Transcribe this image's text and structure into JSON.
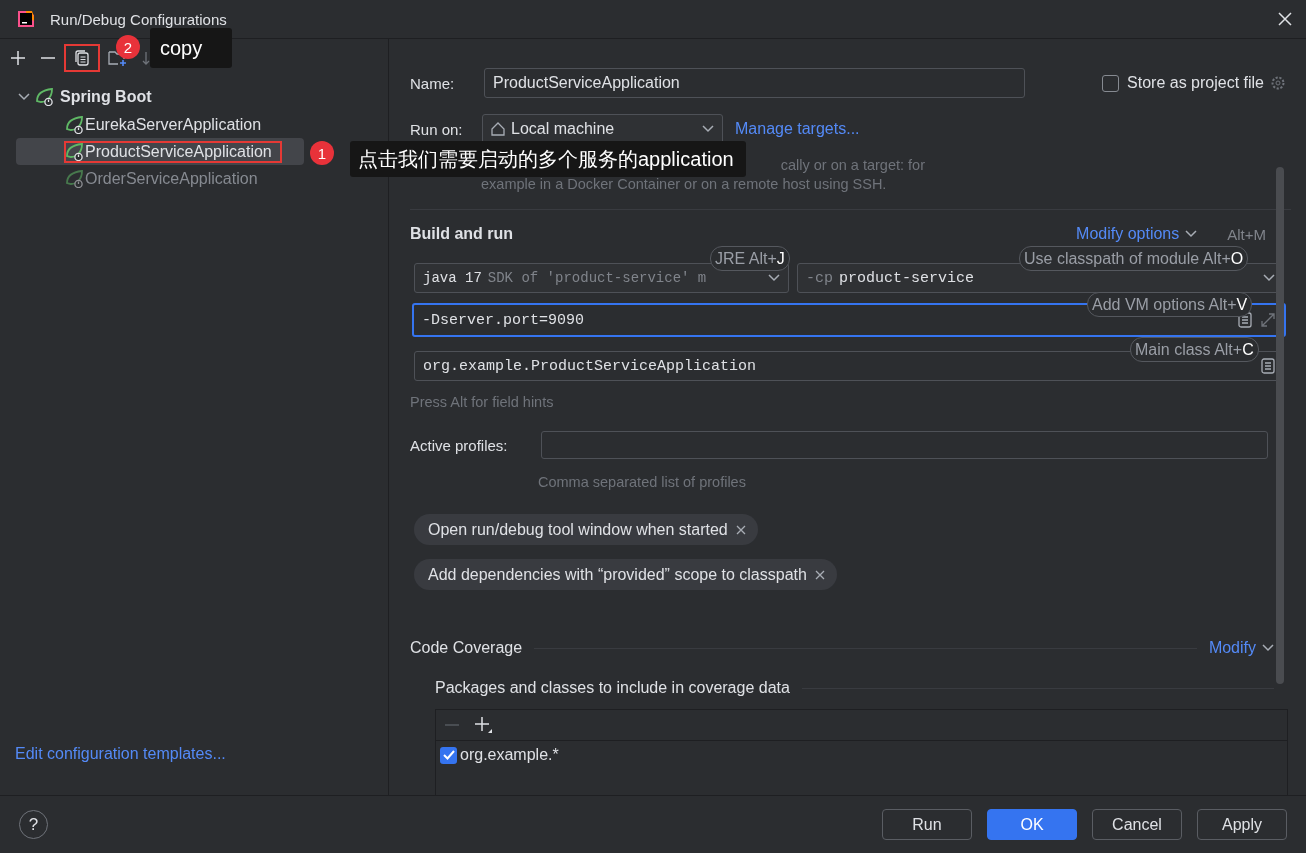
{
  "window": {
    "title": "Run/Debug Configurations"
  },
  "tree": {
    "label": "Spring Boot",
    "expanded": true,
    "children": [
      {
        "label": "EurekaServerApplication",
        "selected": false,
        "disabled": false,
        "highlighted": false
      },
      {
        "label": "ProductServiceApplication",
        "selected": true,
        "disabled": false,
        "highlighted": true
      },
      {
        "label": "OrderServiceApplication",
        "selected": false,
        "disabled": true,
        "highlighted": false
      }
    ]
  },
  "copy_highlighted": true,
  "templates_link": "Edit configuration templates...",
  "name": {
    "label": "Name:",
    "value": "ProductServiceApplication"
  },
  "store": {
    "label": "Store as project file",
    "checked": false
  },
  "run_on": {
    "label": "Run on:",
    "value": "Local machine",
    "link": "Manage targets...",
    "hint": [
      "cally or on a target: for",
      "example in a Docker Container or on a remote host using SSH."
    ]
  },
  "build": {
    "title": "Build and run",
    "modify": "Modify options",
    "modify_shortcut": "Alt+M",
    "jre": "java 17",
    "jre_hint": "SDK of 'product-service' m",
    "cp_prefix": "-cp",
    "cp_value": "product-service",
    "vm_options": "-Dserver.port=9090",
    "vm_focused": true,
    "main_class": "org.example.ProductServiceApplication",
    "field_hint": "Press Alt for field hints"
  },
  "shortcut_hints": [
    {
      "kind": "jre",
      "text": "JRE Alt+",
      "key": "J"
    },
    {
      "kind": "classpath",
      "text": "Use classpath of module Alt+",
      "key": "O"
    },
    {
      "kind": "vm",
      "text": "Add VM options Alt+",
      "key": "V"
    },
    {
      "kind": "main",
      "text": "Main class Alt+",
      "key": "C"
    }
  ],
  "profiles": {
    "label": "Active profiles:",
    "hint": "Comma separated list of profiles"
  },
  "options": [
    "Open run/debug tool window when started",
    "Add dependencies with “provided” scope to classpath"
  ],
  "coverage": {
    "title": "Code Coverage",
    "modify": "Modify",
    "subtitle": "Packages and classes to include in coverage data",
    "items": [
      {
        "label": "org.example.*",
        "checked": true
      }
    ]
  },
  "help": "?",
  "buttons": [
    {
      "label": "Run",
      "primary": false
    },
    {
      "label": "OK",
      "primary": true
    },
    {
      "label": "Cancel",
      "primary": false
    },
    {
      "label": "Apply",
      "primary": false
    }
  ],
  "annotations": [
    {
      "kind": "copy",
      "number": "2",
      "text": "copy"
    },
    {
      "kind": "item",
      "number": "1",
      "text": "点击我们需要启动的多个服务的application"
    }
  ]
}
